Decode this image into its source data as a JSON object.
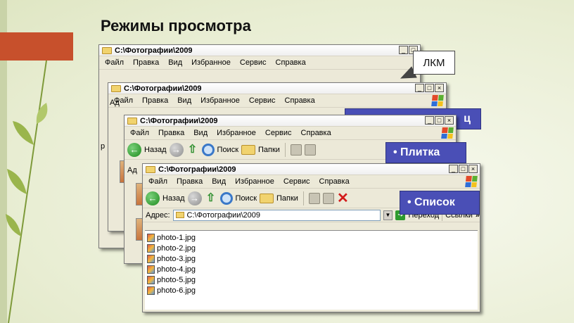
{
  "slide_title": "Режимы просмотра",
  "window_title": "C:\\Фотографии\\2009",
  "menu": [
    "Файл",
    "Правка",
    "Вид",
    "Избранное",
    "Сервис",
    "Справка"
  ],
  "menu_partial": [
    "Файл",
    "Правка",
    "Вид",
    "Избранное",
    "Сервис",
    "Справка"
  ],
  "toolbar": {
    "back": "Назад",
    "search": "Поиск",
    "folders": "Папки"
  },
  "address": {
    "label": "Адрес:",
    "value": "C:\\Фотографии\\2009",
    "go": "Переход",
    "links": "Ссылки",
    "more": "»"
  },
  "window_controls": {
    "minimize": "_",
    "maximize": "□",
    "close": "×"
  },
  "callouts": {
    "lkm": "ЛКМ",
    "table": "ц",
    "tile": "• Плитка",
    "list": "• Список"
  },
  "stub_labels": {
    "adr": "Ад",
    "r": "р"
  },
  "files": [
    "photo-1.jpg",
    "photo-2.jpg",
    "photo-3.jpg",
    "photo-4.jpg",
    "photo-5.jpg",
    "photo-6.jpg"
  ],
  "colors": {
    "accent_red": "#c7502c",
    "callout_blue": "#4a4fb6",
    "window_bg": "#ece9d8"
  }
}
